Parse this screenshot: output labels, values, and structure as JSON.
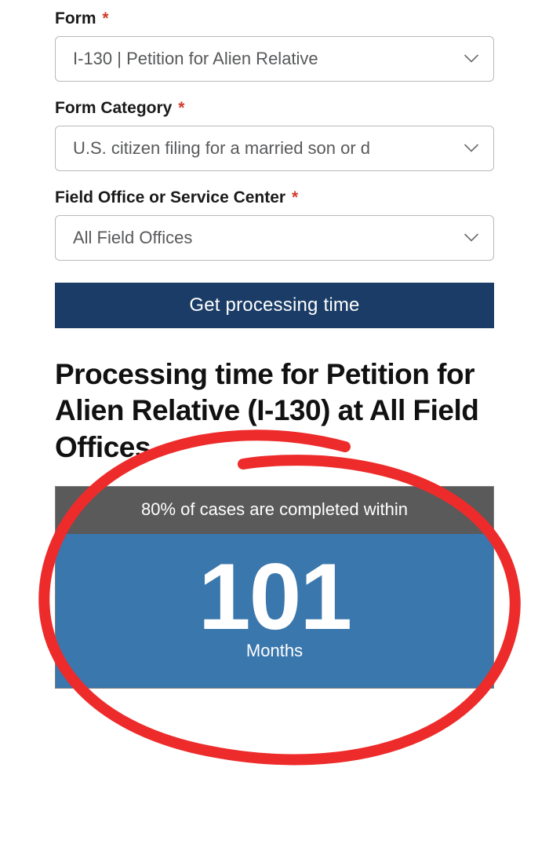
{
  "fields": {
    "form": {
      "label": "Form",
      "value": "I-130 | Petition for Alien Relative"
    },
    "category": {
      "label": "Form Category",
      "value": "U.S. citizen filing for a married son or d"
    },
    "office": {
      "label": "Field Office or Service Center",
      "value": "All Field Offices"
    }
  },
  "submit_label": "Get processing time",
  "result": {
    "heading": "Processing time for Petition for Alien Relative (I-130) at All Field Offices",
    "card_head": "80% of cases are completed within",
    "number": "101",
    "unit": "Months"
  }
}
